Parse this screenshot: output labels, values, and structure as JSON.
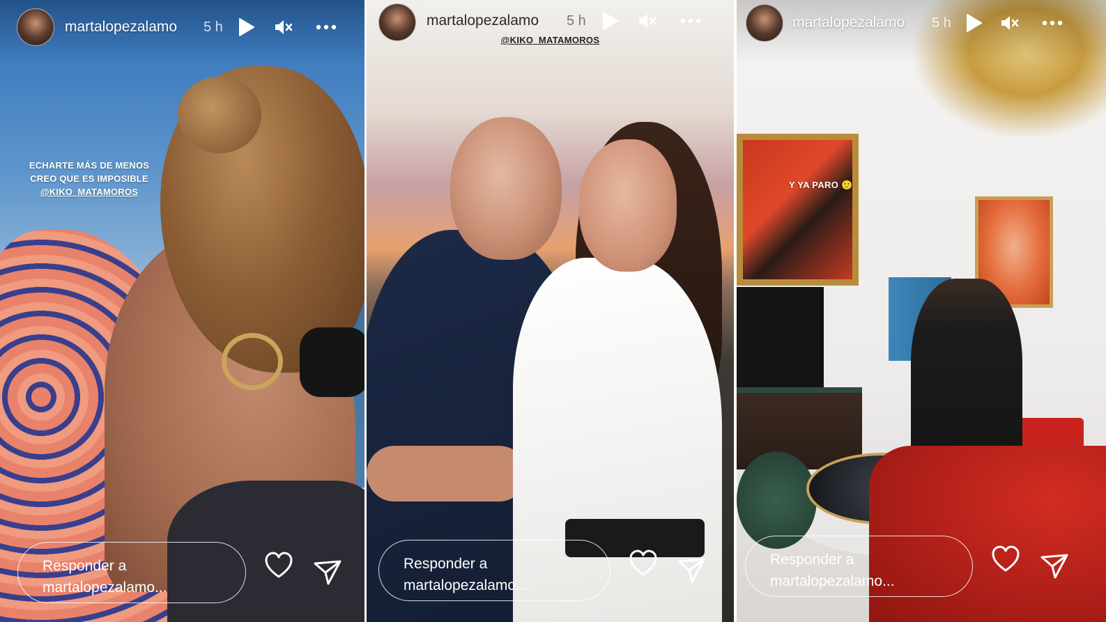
{
  "stories": [
    {
      "username": "martalopezalamo",
      "time": "5 h",
      "caption_lines": [
        "ECHARTE MÁS DE MENOS",
        "CREO QUE ES IMPOSIBLE"
      ],
      "mention": "@KIKO_MATAMOROS",
      "reply_line1": "Responder a",
      "reply_line2": "martalopezalamo..."
    },
    {
      "username": "martalopezalamo",
      "time": "5 h",
      "mention": "@KIKO_MATAMOROS",
      "reply_line1": "Responder a",
      "reply_line2": "martalopezalamo..."
    },
    {
      "username": "martalopezalamo",
      "time": "5 h",
      "caption": "Y YA PARO 🙂",
      "reply_line1": "Responder a",
      "reply_line2": "martalopezalamo..."
    }
  ],
  "icons": {
    "play": "play-icon",
    "mute": "speaker-muted-icon",
    "more": "more-options-icon",
    "like": "heart-icon",
    "share": "send-icon"
  },
  "colors": {
    "overlay_text_light": "#ffffff",
    "overlay_text_dark": "#2a2a2a"
  }
}
